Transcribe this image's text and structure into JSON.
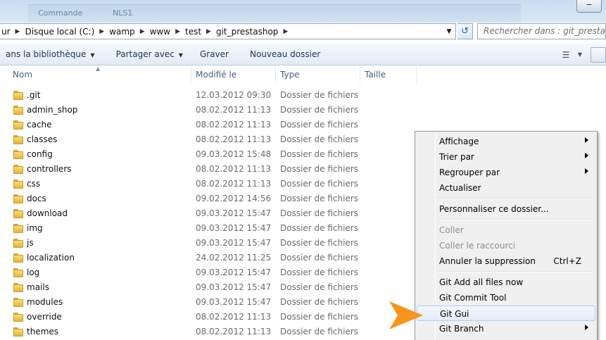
{
  "window": {
    "behind_texts": [
      "Commande",
      "NLS1"
    ],
    "controls_label": "−"
  },
  "address": {
    "crumbs": [
      "ur",
      "Disque local (C:)",
      "wamp",
      "www",
      "test",
      "git_prestashop"
    ],
    "search_placeholder": "Rechercher dans : git_prestashop"
  },
  "toolbar": {
    "library_label": "ans la bibliothèque",
    "share_label": "Partager avec",
    "burn_label": "Graver",
    "new_folder_label": "Nouveau dossier"
  },
  "columns": {
    "name": "Nom",
    "modified": "Modifié le",
    "type": "Type",
    "size": "Taille"
  },
  "files": [
    {
      "name": ".git",
      "date": "12.03.2012 09:30",
      "type": "Dossier de fichiers"
    },
    {
      "name": "admin_shop",
      "date": "08.02.2012 11:13",
      "type": "Dossier de fichiers"
    },
    {
      "name": "cache",
      "date": "08.02.2012 11:13",
      "type": "Dossier de fichiers"
    },
    {
      "name": "classes",
      "date": "08.02.2012 11:13",
      "type": "Dossier de fichiers"
    },
    {
      "name": "config",
      "date": "09.03.2012 15:48",
      "type": "Dossier de fichiers"
    },
    {
      "name": "controllers",
      "date": "08.02.2012 11:13",
      "type": "Dossier de fichiers"
    },
    {
      "name": "css",
      "date": "08.02.2012 11:13",
      "type": "Dossier de fichiers"
    },
    {
      "name": "docs",
      "date": "09.02.2012 14:56",
      "type": "Dossier de fichiers"
    },
    {
      "name": "download",
      "date": "09.03.2012 15:47",
      "type": "Dossier de fichiers"
    },
    {
      "name": "img",
      "date": "09.03.2012 15:47",
      "type": "Dossier de fichiers"
    },
    {
      "name": "js",
      "date": "09.03.2012 15:47",
      "type": "Dossier de fichiers"
    },
    {
      "name": "localization",
      "date": "24.02.2012 11:25",
      "type": "Dossier de fichiers"
    },
    {
      "name": "log",
      "date": "09.03.2012 15:47",
      "type": "Dossier de fichiers"
    },
    {
      "name": "mails",
      "date": "09.03.2012 15:47",
      "type": "Dossier de fichiers"
    },
    {
      "name": "modules",
      "date": "09.03.2012 15:47",
      "type": "Dossier de fichiers"
    },
    {
      "name": "override",
      "date": "08.02.2012 11:13",
      "type": "Dossier de fichiers"
    },
    {
      "name": "themes",
      "date": "08.02.2012 11:13",
      "type": "Dossier de fichiers"
    }
  ],
  "context_menu": {
    "items": [
      {
        "label": "Affichage",
        "submenu": true
      },
      {
        "label": "Trier par",
        "submenu": true
      },
      {
        "label": "Regrouper par",
        "submenu": true
      },
      {
        "label": "Actualiser"
      },
      {
        "separator": true
      },
      {
        "label": "Personnaliser ce dossier..."
      },
      {
        "separator": true
      },
      {
        "label": "Coller",
        "disabled": true
      },
      {
        "label": "Coller le raccourci",
        "disabled": true
      },
      {
        "label": "Annuler la suppression",
        "shortcut": "Ctrl+Z"
      },
      {
        "separator": true
      },
      {
        "label": "Git Add all files now"
      },
      {
        "label": "Git Commit Tool"
      },
      {
        "label": "Git Gui",
        "highlighted": true
      },
      {
        "label": "Git Branch",
        "submenu": true
      }
    ]
  },
  "colors": {
    "pointer": "#f7941d",
    "highlight_border": "#aecff7"
  }
}
